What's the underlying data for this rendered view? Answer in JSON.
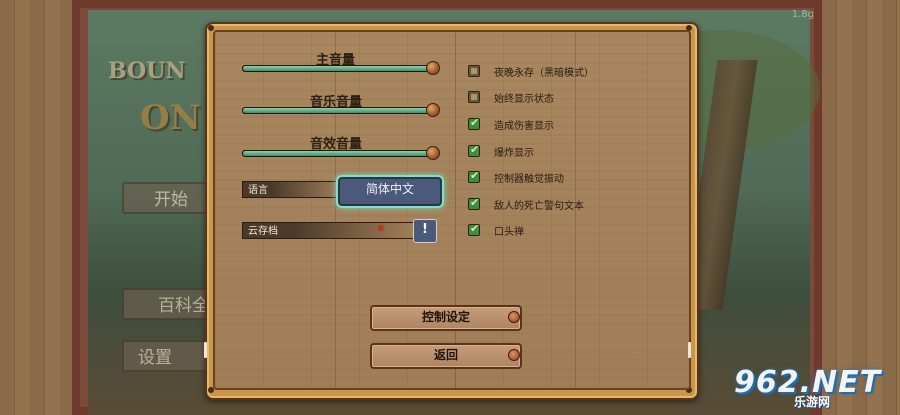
{
  "background": {
    "version": "1.8g",
    "title_word1": "BOUN",
    "title_word2": "ON",
    "menu_items": [
      "开始",
      "百科全",
      "设置"
    ]
  },
  "settings": {
    "sliders": [
      {
        "label": "主音量",
        "value": 1.0
      },
      {
        "label": "音乐音量",
        "value": 1.0
      },
      {
        "label": "音效音量",
        "value": 1.0
      }
    ],
    "language": {
      "label": "语言",
      "value": "简体中文"
    },
    "cloud_save": {
      "label": "云存档",
      "button": "!"
    },
    "toggles": [
      {
        "label": "夜晚永存（黑暗模式）",
        "checked": false
      },
      {
        "label": "始终显示状态",
        "checked": false
      },
      {
        "label": "造成伤害显示",
        "checked": true
      },
      {
        "label": "爆炸显示",
        "checked": true
      },
      {
        "label": "控制器触觉振动",
        "checked": true
      },
      {
        "label": "敌人的死亡警句文本",
        "checked": true
      },
      {
        "label": "口头禅",
        "checked": true
      }
    ],
    "buttons": {
      "controls": "控制设定",
      "back": "返回"
    }
  },
  "watermark": {
    "number": "962.NET",
    "sub": "乐游网"
  },
  "colors": {
    "accent_teal": "#7fe3c2",
    "slider_fill": "#3f8f6a",
    "checkbox_on": "#3f8f3a"
  }
}
